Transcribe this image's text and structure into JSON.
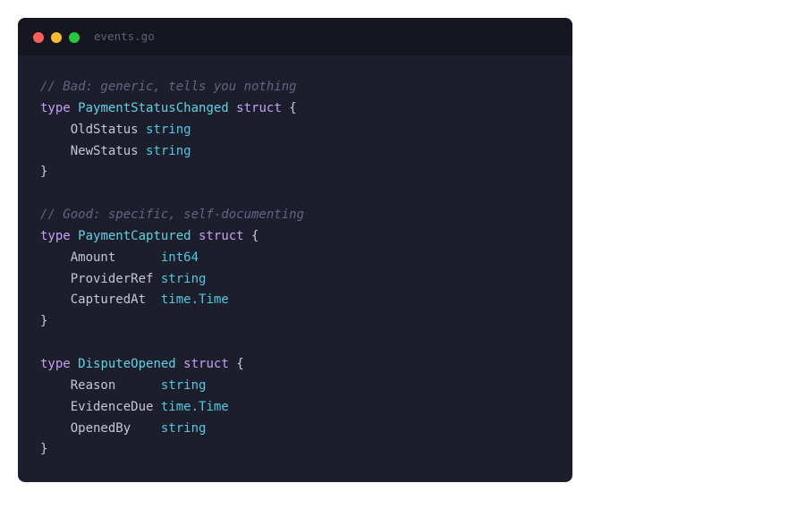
{
  "window": {
    "filename": "events.go",
    "accent_colors": {
      "close": "#ff5f57",
      "minimize": "#febc2e",
      "maximize": "#28c840"
    }
  },
  "code": {
    "lines": [
      {
        "type": "comment",
        "text": "// Bad: generic, tells you nothing"
      },
      {
        "type": "decl",
        "kw": "type",
        "name": "PaymentStatusChanged",
        "struct": "struct",
        "brace": "{"
      },
      {
        "type": "field",
        "indent": "    ",
        "name": "OldStatus",
        "pad": " ",
        "ftype": "string"
      },
      {
        "type": "field",
        "indent": "    ",
        "name": "NewStatus",
        "pad": " ",
        "ftype": "string"
      },
      {
        "type": "close",
        "text": "}"
      },
      {
        "type": "blank",
        "text": ""
      },
      {
        "type": "comment",
        "text": "// Good: specific, self-documenting"
      },
      {
        "type": "decl",
        "kw": "type",
        "name": "PaymentCaptured",
        "struct": "struct",
        "brace": "{"
      },
      {
        "type": "field",
        "indent": "    ",
        "name": "Amount",
        "pad": "      ",
        "ftype": "int64"
      },
      {
        "type": "field",
        "indent": "    ",
        "name": "ProviderRef",
        "pad": " ",
        "ftype": "string"
      },
      {
        "type": "field",
        "indent": "    ",
        "name": "CapturedAt",
        "pad": "  ",
        "ftype": "time.Time"
      },
      {
        "type": "close",
        "text": "}"
      },
      {
        "type": "blank",
        "text": ""
      },
      {
        "type": "decl",
        "kw": "type",
        "name": "DisputeOpened",
        "struct": "struct",
        "brace": "{"
      },
      {
        "type": "field",
        "indent": "    ",
        "name": "Reason",
        "pad": "      ",
        "ftype": "string"
      },
      {
        "type": "field",
        "indent": "    ",
        "name": "EvidenceDue",
        "pad": " ",
        "ftype": "time.Time"
      },
      {
        "type": "field",
        "indent": "    ",
        "name": "OpenedBy",
        "pad": "    ",
        "ftype": "string"
      },
      {
        "type": "close",
        "text": "}"
      }
    ]
  }
}
